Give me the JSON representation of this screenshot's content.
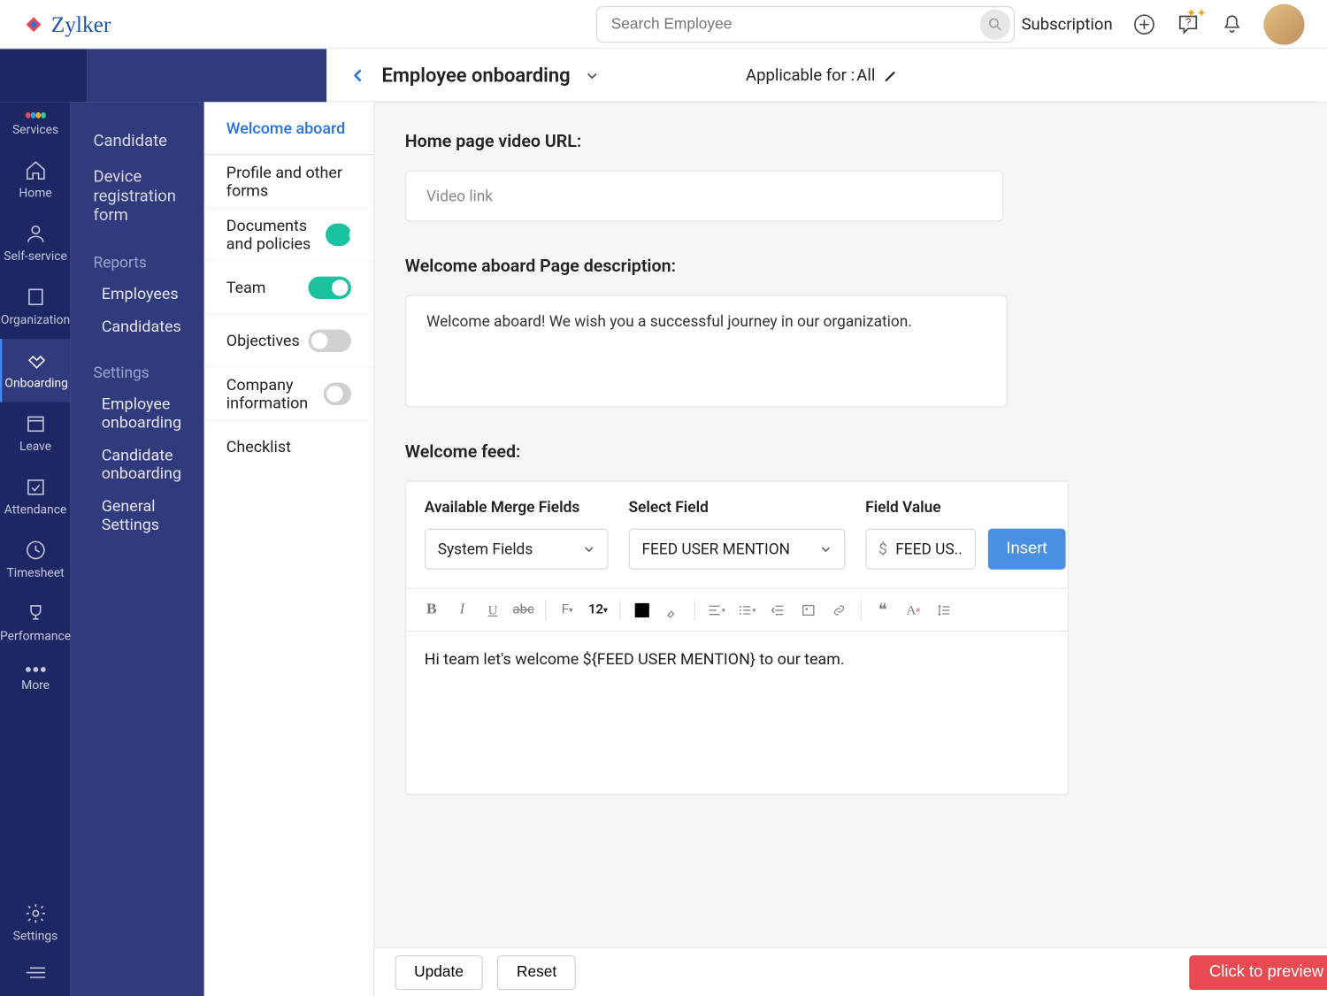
{
  "brand": "Zylker",
  "search_placeholder": "Search Employee",
  "top_links": {
    "subscription": "Subscription"
  },
  "rail": {
    "items": [
      {
        "label": "Services"
      },
      {
        "label": "Home"
      },
      {
        "label": "Self-service"
      },
      {
        "label": "Organization"
      },
      {
        "label": "Onboarding"
      },
      {
        "label": "Leave"
      },
      {
        "label": "Attendance"
      },
      {
        "label": "Timesheet"
      },
      {
        "label": "Performance"
      },
      {
        "label": "More"
      },
      {
        "label": "Settings"
      }
    ]
  },
  "secnav": {
    "top": [
      "Candidate",
      "Device registration form"
    ],
    "reports_header": "Reports",
    "reports": [
      "Employees",
      "Candidates"
    ],
    "settings_header": "Settings",
    "settings": [
      "Employee onboarding",
      "Candidate onboarding",
      "General Settings"
    ]
  },
  "header": {
    "title": "Employee onboarding",
    "applicable_label": "Applicable for :",
    "applicable_value": "All"
  },
  "tabs": [
    {
      "label": "Welcome aboard",
      "toggle": null,
      "active": true
    },
    {
      "label": "Profile and other forms",
      "toggle": null
    },
    {
      "label": "Documents and policies",
      "toggle": "on"
    },
    {
      "label": "Team",
      "toggle": "on"
    },
    {
      "label": "Objectives",
      "toggle": "off"
    },
    {
      "label": "Company information",
      "toggle": "off"
    },
    {
      "label": "Checklist",
      "toggle": null
    }
  ],
  "sections": {
    "video_label": "Home page video URL:",
    "video_placeholder": "Video link",
    "desc_label": "Welcome aboard Page description:",
    "desc_value": "Welcome aboard! We wish you a successful journey in our organization.",
    "feed_label": "Welcome feed:",
    "merge": {
      "col1_label": "Available Merge Fields",
      "col1_value": "System Fields",
      "col2_label": "Select Field",
      "col2_value": "FEED USER MENTION",
      "col3_label": "Field Value",
      "col3_value": "FEED US..",
      "insert": "Insert"
    },
    "editor_fontsize": "12",
    "editor_text": "Hi team let's welcome ${FEED USER MENTION} to our team."
  },
  "footer": {
    "update": "Update",
    "reset": "Reset",
    "preview": "Click to preview"
  }
}
